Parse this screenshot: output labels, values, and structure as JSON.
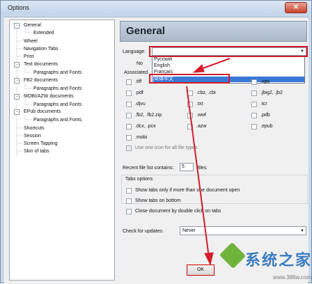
{
  "window": {
    "title": "Options",
    "close_glyph": "✕"
  },
  "tree": {
    "items": [
      {
        "label": "General",
        "level": 0,
        "expander": "−"
      },
      {
        "label": "Extended",
        "level": 1
      },
      {
        "label": "Wheel",
        "level": 0
      },
      {
        "label": "Navigation Tabs",
        "level": 0
      },
      {
        "label": "Print",
        "level": 0
      },
      {
        "label": "Text documents",
        "level": 0,
        "expander": "−"
      },
      {
        "label": "Paragraphs and Fonts",
        "level": 1
      },
      {
        "label": "FB2 documents",
        "level": 0,
        "expander": "−"
      },
      {
        "label": "Paragraphs and Fonts",
        "level": 1
      },
      {
        "label": "MOBI/AZW documents",
        "level": 0,
        "expander": "−"
      },
      {
        "label": "Paragraphs and Fonts",
        "level": 1
      },
      {
        "label": "EPub documents",
        "level": 0,
        "expander": "−"
      },
      {
        "label": "Paragraphs and Fonts",
        "level": 1
      },
      {
        "label": "Shortcuts",
        "level": 0
      },
      {
        "label": "Session",
        "level": 0
      },
      {
        "label": "Screen Tapping",
        "level": 0
      },
      {
        "label": "Skin of tabs",
        "level": 0
      }
    ]
  },
  "general": {
    "heading": "General",
    "language_label": "Language:",
    "language_value": "",
    "language_options": [
      "Русский",
      "English",
      "Français",
      "简体中文"
    ],
    "no_label": "No",
    "associated_label": "Associated",
    "file_types": [
      [
        ".tiff",
        "",
        ".xps"
      ],
      [
        ".pdf",
        ".cbz, .cbr",
        ".jbig2, .jb2"
      ],
      [
        ".djvu",
        ".txt",
        ".tcr"
      ],
      [
        ".fb2, .fb2.zip",
        ".wwf",
        ".pdb"
      ],
      [
        ".dcx, .pcx",
        ".azw",
        ".epub"
      ],
      [
        ".mobi",
        "",
        ""
      ]
    ],
    "use_one_icon": "Use one icon for all file types",
    "recent_label": "Recent file list contains:",
    "recent_value": "5",
    "recent_unit": "files",
    "tabs_options_label": "Tabs options",
    "tabs_opt1": "Show tabs only if more than one document open",
    "tabs_opt2": "Show tabs on bottom",
    "tabs_opt3": "Close document by double click on tabs",
    "updates_label": "Check for updates:",
    "updates_value": "Never",
    "ok_label": "OK"
  },
  "watermark": {
    "text": "系统之家",
    "url": "www.386w.com"
  },
  "colors": {
    "highlight": "#3a78d7",
    "annotation": "#d41c2b",
    "header_bg": "#b8c6d6"
  }
}
